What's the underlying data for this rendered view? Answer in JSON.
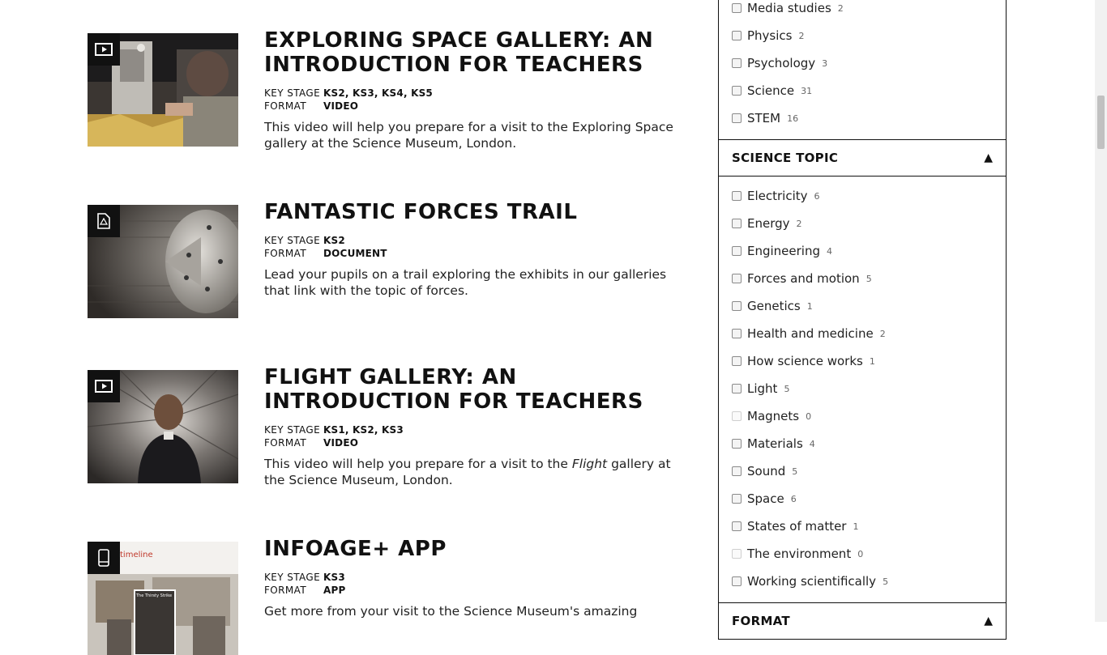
{
  "labels": {
    "key_stage": "KEY STAGE",
    "format": "FORMAT"
  },
  "resources": [
    {
      "title": "EXPLORING SPACE GALLERY: AN INTRODUCTION FOR TEACHERS",
      "key_stage": "KS2, KS3, KS4, KS5",
      "format": "VIDEO",
      "description": "This video will help you prepare for a visit to the Exploring Space gallery at the Science Museum, London.",
      "icon": "video-icon"
    },
    {
      "title": "FANTASTIC FORCES TRAIL",
      "key_stage": "KS2",
      "format": "DOCUMENT",
      "description": "Lead your pupils on a trail exploring the exhibits in our galleries that link with the topic of forces.",
      "icon": "document-icon"
    },
    {
      "title": "FLIGHT GALLERY: AN INTRODUCTION FOR TEACHERS",
      "key_stage": "KS1, KS2, KS3",
      "format": "VIDEO",
      "description_pre": "This video will help you prepare for a visit to the ",
      "description_em": "Flight",
      "description_post": " gallery at the Science Museum, London.",
      "icon": "video-icon"
    },
    {
      "title": "INFOAGE+ APP",
      "key_stage": "KS3",
      "format": "APP",
      "description": "Get more from your visit to the Science Museum's amazing",
      "thumb_text": "timeline",
      "thumb_caption": "The Thirsty Strike",
      "icon": "mobile-icon"
    }
  ],
  "subject_filters": [
    {
      "label": "Media studies",
      "count": "2"
    },
    {
      "label": "Physics",
      "count": "2"
    },
    {
      "label": "Psychology",
      "count": "3"
    },
    {
      "label": "Science",
      "count": "31"
    },
    {
      "label": "STEM",
      "count": "16"
    }
  ],
  "science_topic": {
    "header": "SCIENCE TOPIC",
    "arrow": "▲",
    "items": [
      {
        "label": "Electricity",
        "count": "6"
      },
      {
        "label": "Energy",
        "count": "2"
      },
      {
        "label": "Engineering",
        "count": "4"
      },
      {
        "label": "Forces and motion",
        "count": "5"
      },
      {
        "label": "Genetics",
        "count": "1"
      },
      {
        "label": "Health and medicine",
        "count": "2"
      },
      {
        "label": "How science works",
        "count": "1"
      },
      {
        "label": "Light",
        "count": "5"
      },
      {
        "label": "Magnets",
        "count": "0"
      },
      {
        "label": "Materials",
        "count": "4"
      },
      {
        "label": "Sound",
        "count": "5"
      },
      {
        "label": "Space",
        "count": "6"
      },
      {
        "label": "States of matter",
        "count": "1"
      },
      {
        "label": "The environment",
        "count": "0"
      },
      {
        "label": "Working scientifically",
        "count": "5"
      }
    ]
  },
  "format_section": {
    "header": "FORMAT",
    "arrow": "▲"
  }
}
